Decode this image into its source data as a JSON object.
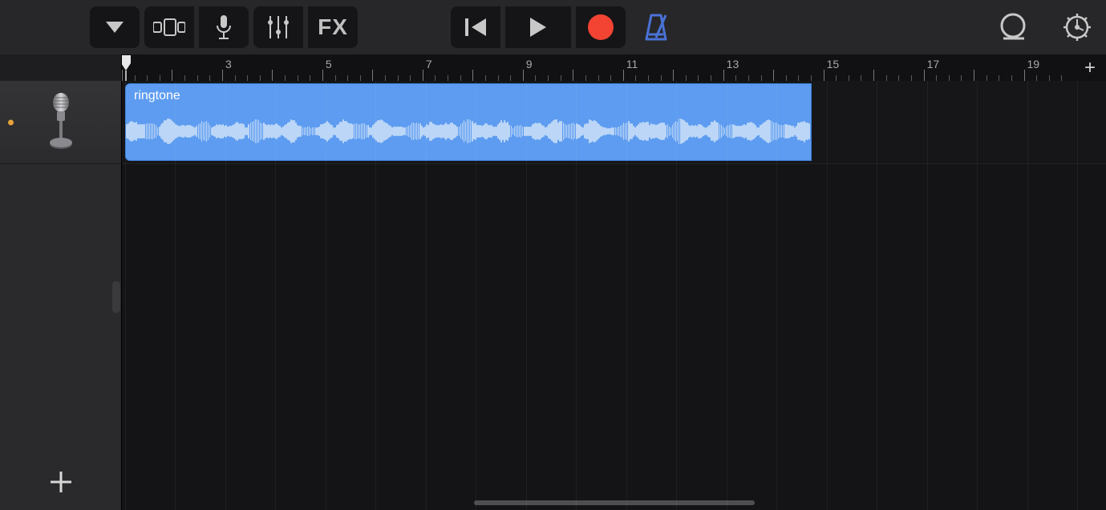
{
  "toolbar": {
    "dropdown_icon": "triangle-down",
    "browser_icon": "track-layout",
    "mic_icon": "microphone",
    "mixer_icon": "sliders",
    "fx_label": "FX",
    "rewind_icon": "rewind-start",
    "play_icon": "play",
    "record_icon": "record",
    "record_color": "#f24333",
    "metronome_icon": "metronome",
    "metronome_color": "#4a72d8",
    "loop_icon": "cycle-loop",
    "settings_icon": "gear"
  },
  "ruler": {
    "numbers": [
      3,
      5,
      7,
      9,
      11,
      13,
      15,
      17,
      19
    ],
    "bars_total": 20,
    "beats_per_bar": 4,
    "playhead_bar": 1,
    "add_section_label": "+"
  },
  "track": {
    "icon": "microphone-stand",
    "status_dot_color": "#e8a33c",
    "region": {
      "name": "ringtone",
      "color": "#5d9cf0",
      "start_bar": 1,
      "end_bar": 14.7
    }
  },
  "add_track_label": "+"
}
